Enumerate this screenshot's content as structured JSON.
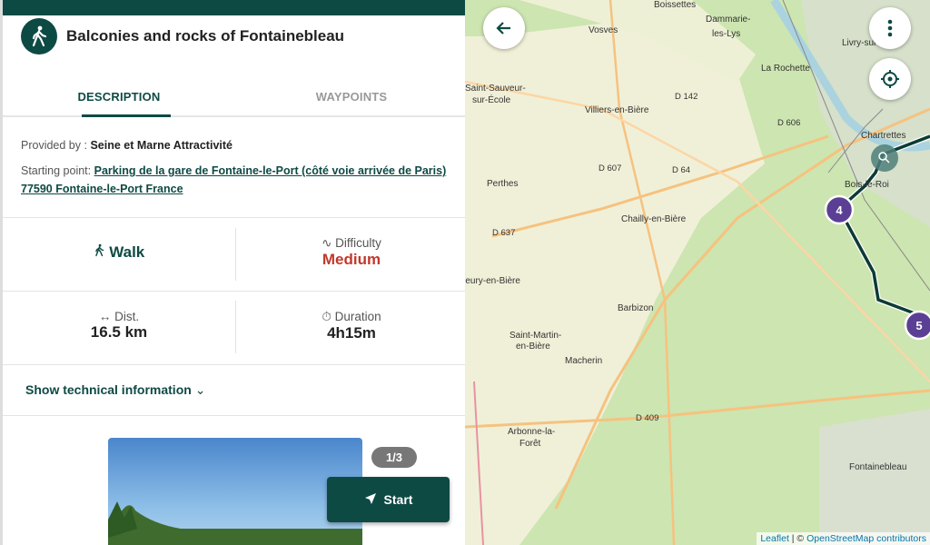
{
  "trek": {
    "title": "Balconies and rocks of Fontainebleau",
    "icon": "walker-icon"
  },
  "tabs": [
    {
      "label": "DESCRIPTION",
      "active": true
    },
    {
      "label": "WAYPOINTS",
      "active": false
    }
  ],
  "provided_by": {
    "label": "Provided by :",
    "value": "Seine et Marne Attractivité"
  },
  "starting_point": {
    "label": "Starting point:",
    "value": "Parking de la gare de Fontaine-le-Port (côté voie arrivée de Paris) 77590 Fontaine-le-Port France"
  },
  "stats": {
    "practice": {
      "value": "Walk",
      "icon": "walker-icon"
    },
    "difficulty": {
      "label": "Difficulty",
      "value": "Medium",
      "color": "#c0392b",
      "icon": "difficulty-wave-icon"
    },
    "distance": {
      "label": "Dist.",
      "value": "16.5 km",
      "icon": "distance-arrows-icon"
    },
    "duration": {
      "label": "Duration",
      "value": "4h15m",
      "icon": "stopwatch-icon"
    }
  },
  "technical_toggle": "Show technical information",
  "gallery": {
    "counter": "1/3"
  },
  "start_button": "Start",
  "colors": {
    "primary": "#0e4a44",
    "marker": "#5b3f94"
  },
  "map": {
    "places": [
      "Boissettes",
      "Dammarie-",
      "les-Lys",
      "Vosves",
      "Livry-sur-Seine",
      "Saint-Sauveur-",
      "sur-École",
      "Villiers-en-Bière",
      "La Rochette",
      "Chartrettes",
      "Perthes",
      "Bois-le-Roi",
      "Chailly-en-Bière",
      "Fleury-en-Bière",
      "Barbizon",
      "Saint-Martin-",
      "en-Bière",
      "Macherin",
      "Arbonne-la-",
      "Forêt",
      "Fontainebleau"
    ],
    "roads": [
      "D 142",
      "D 606",
      "D 607",
      "D 64",
      "D 637",
      "D 409"
    ],
    "markers": [
      "4",
      "5"
    ],
    "attribution": {
      "leaflet": "Leaflet",
      "sep": " | © ",
      "osm": "OpenStreetMap contributors"
    }
  }
}
